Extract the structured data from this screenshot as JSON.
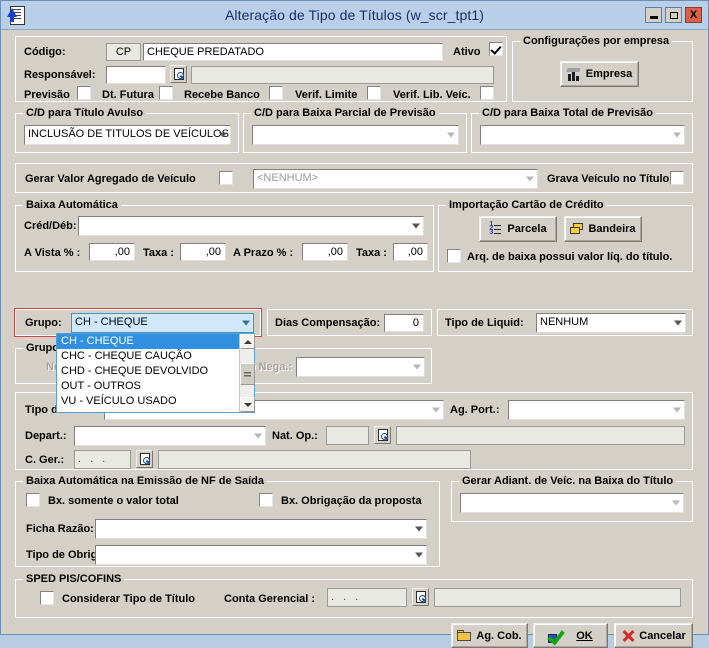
{
  "window": {
    "title": "Alteração de Tipo de Títulos (w_scr_tpt1)",
    "icon": "document-arrow-icon",
    "buttons": {
      "minimize": "–",
      "maximize": "□",
      "close": "X"
    }
  },
  "header": {
    "codigo_label": "Código:",
    "codigo_prefix": "CP",
    "codigo_value": "CHEQUE PREDATADO",
    "ativo_label": "Ativo",
    "ativo_checked": true,
    "responsavel_label": "Responsável:",
    "responsavel_value": "",
    "responsavel_desc": "",
    "checks": [
      {
        "label": "Previsão",
        "checked": false
      },
      {
        "label": "Dt. Futura",
        "checked": false
      },
      {
        "label": "Recebe Banco",
        "checked": false
      },
      {
        "label": "Verif. Limite",
        "checked": false
      },
      {
        "label": "Verif. Lib. Veíc.",
        "checked": false
      }
    ]
  },
  "empresa_panel": {
    "legend": "Configurações por empresa",
    "button_label": "Empresa"
  },
  "cd_groups": [
    {
      "legend": "C/D para Título Avulso",
      "value": "INCLUSÃO DE TITULOS DE VEÍCULOS"
    },
    {
      "legend": "C/D para Baixa Parcial de Previsão",
      "value": ""
    },
    {
      "legend": "C/D para Baixa Total de Previsão",
      "value": ""
    }
  ],
  "veiculo_row": {
    "gerar_label": "Gerar Valor Agregado de Veículo",
    "gerar_checked": false,
    "combo_value": "<NENHUM>",
    "grava_label": "Grava Veículo no Título",
    "grava_checked": false
  },
  "baixa_automatica": {
    "legend": "Baixa Automática",
    "cred_deb_label": "Créd/Déb:",
    "cred_deb_value": "",
    "a_vista_label": "A Vista % :",
    "a_vista_value": ",00",
    "taxa1_label": "Taxa :",
    "taxa1_value": ",00",
    "a_prazo_label": "A Prazo % :",
    "a_prazo_value": ",00",
    "taxa2_label": "Taxa :",
    "taxa2_value": ",00"
  },
  "importacao_cartao": {
    "legend": "Importação Cartão de Crédito",
    "parcela_label": "Parcela",
    "bandeira_label": "Bandeira",
    "arq_label": "Arq. de baixa possui valor líq. do título.",
    "arq_checked": false
  },
  "grupo_row": {
    "grupo_label": "Grupo:",
    "grupo_value": "CH  - CHEQUE",
    "dias_label": "Dias Compensação:",
    "dias_value": "0",
    "tipo_liquid_label": "Tipo de Liquid:",
    "tipo_liquid_value": "NENHUM"
  },
  "grupo_dropdown": {
    "open": true,
    "options": [
      {
        "label": "CH  - CHEQUE",
        "selected": true
      },
      {
        "label": "CHC - CHEQUE CAUÇÃO",
        "selected": false
      },
      {
        "label": "CHD - CHEQUE DEVOLVIDO",
        "selected": false
      },
      {
        "label": "OUT - OUTROS",
        "selected": false
      },
      {
        "label": "VU - VEÍCULO USADO",
        "selected": false
      }
    ]
  },
  "grupo_conc": {
    "legend": "Grupo Concessionária",
    "negativado_label": "Negativado:",
    "motivo_label": "Motivo Nega.:",
    "motivo_value": ""
  },
  "tipo_row": {
    "tipo_titulo_label": "Tipo de Título:",
    "tipo_titulo_value": "",
    "ag_port_label": "Ag. Port.:",
    "ag_port_value": "",
    "depart_label": "Depart.:",
    "depart_value": "",
    "nat_op_label": "Nat. Op.:",
    "nat_op_value": "",
    "nat_op_desc": "",
    "c_ger_label": "C. Ger.:",
    "c_ger_value": ". . .",
    "c_ger_desc": ""
  },
  "baixa_nf": {
    "legend": "Baixa Automática na Emissão de NF de Saída",
    "check1_label": "Bx. somente o valor total",
    "check1_checked": false,
    "check2_label": "Bx. Obrigação da proposta",
    "check2_checked": false,
    "ficha_label": "Ficha Razão:",
    "ficha_value": "",
    "obrig_label": "Tipo de Obrig.:",
    "obrig_value": ""
  },
  "gerar_adiant": {
    "legend": "Gerar Adiant. de Veíc. na Baixa do Título",
    "value": ""
  },
  "sped": {
    "legend": "SPED PIS/COFINS",
    "considerar_label": "Considerar Tipo de Título",
    "considerar_checked": false,
    "conta_label": "Conta Gerencial :",
    "conta_value": ". . .",
    "conta_desc": ""
  },
  "footer": {
    "ag_cob_label": "Ag. Cob.",
    "ok_label": "OK",
    "cancelar_label": "Cancelar"
  },
  "colors": {
    "titlebar": "#b9cfe7",
    "face": "#d4d0c8",
    "desktop": "#b8cce4",
    "close_button": "#d9614b",
    "selection": "#2f8fe0",
    "focus_field": "#cfe8fb",
    "highlight_border": "#d04444"
  }
}
